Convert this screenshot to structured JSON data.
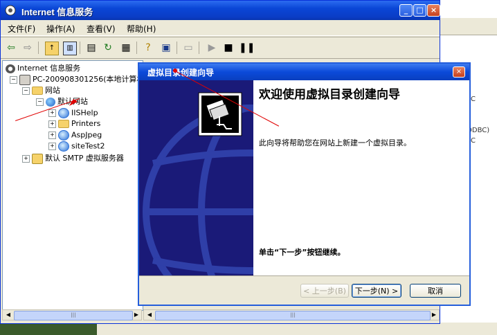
{
  "main_window": {
    "title": "Internet 信息服务",
    "buttons": {
      "minimize": "_",
      "maximize": "□",
      "close": "×"
    }
  },
  "menu": [
    "文件(F)",
    "操作(A)",
    "查看(V)",
    "帮助(H)"
  ],
  "toolbar_icons": [
    "back-arrow-icon",
    "forward-arrow-icon",
    "up-folder-icon",
    "show-tree-icon",
    "properties-icon",
    "refresh-icon",
    "export-icon",
    "help-icon",
    "console-icon",
    "computer-icon",
    "play-icon",
    "stop-icon",
    "pause-icon"
  ],
  "tree": {
    "root": "Internet 信息服务",
    "computer": "PC-200908301256(本地计算机)",
    "websites": "网站",
    "default_site": "默认网站",
    "vdirs": [
      "IISHelp",
      "Printers",
      "AspJpeg",
      "siteTest2"
    ],
    "smtp": "默认 SMTP 虚拟服务器"
  },
  "background_right_text": [
    "C",
    "ODBC)",
    "C"
  ],
  "wizard": {
    "title": "虚拟目录创建向导",
    "heading": "欢迎使用虚拟目录创建向导",
    "description": "此向导将帮助您在网站上新建一个虚拟目录。",
    "hint": "单击“下一步”按钮继续。",
    "buttons": {
      "back": "< 上一步(B)",
      "next": "下一步(N) >",
      "cancel": "取消"
    },
    "close": "×"
  },
  "colors": {
    "titlebar": "#0a46d6",
    "banner": "#1a1a78",
    "annotation": "#e00000"
  }
}
